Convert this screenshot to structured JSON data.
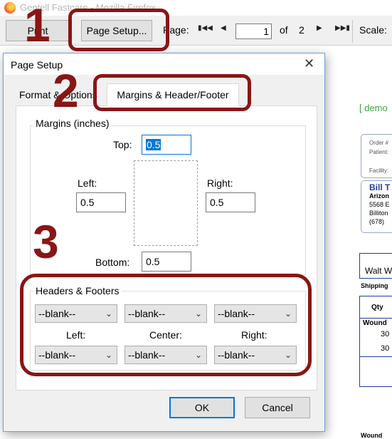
{
  "browser": {
    "window_title": "Gentell Fastcare - Mozilla Firefox",
    "icon": "firefox-logo"
  },
  "toolbar": {
    "print_label": "Print",
    "page_setup_label": "Page Setup...",
    "page_label": "Page:",
    "current_page": "1",
    "of_label": "of",
    "total_pages": "2",
    "scale_label": "Scale:",
    "nav_icons": [
      "first-page-icon",
      "prev-page-icon",
      "next-page-icon",
      "last-page-icon"
    ]
  },
  "document": {
    "demo_text": "[ demo",
    "order_lines": [
      "Order #",
      "Patient:",
      "",
      "Facility:"
    ],
    "bill_name": "Bill T",
    "bill_lines": [
      "Arizon",
      "5568 E",
      "Billiton",
      "(678)"
    ],
    "ship_to": "Walt W",
    "shipping_label": "Shipping",
    "qty_header": "Qty",
    "wound_cell": "Wound",
    "qty_values": [
      "30",
      "30"
    ],
    "wound_bottom": "Wound"
  },
  "dialog": {
    "title": "Page Setup",
    "close_glyph": "✕",
    "tabs": [
      {
        "label": "Format & Options",
        "active": false
      },
      {
        "label": "Margins & Header/Footer",
        "active": true
      }
    ],
    "margins": {
      "legend": "Margins (inches)",
      "top_label": "Top:",
      "top_value": "0.5",
      "left_label": "Left:",
      "left_value": "0.5",
      "right_label": "Right:",
      "right_value": "0.5",
      "bottom_label": "Bottom:",
      "bottom_value": "0.5"
    },
    "headers_footers": {
      "legend": "Headers & Footers",
      "header_left": "--blank--",
      "header_center": "--blank--",
      "header_right": "--blank--",
      "left_label": "Left:",
      "center_label": "Center:",
      "right_label": "Right:",
      "footer_left": "--blank--",
      "footer_center": "--blank--",
      "footer_right": "--blank--"
    },
    "ok_label": "OK",
    "cancel_label": "Cancel"
  },
  "annotations": {
    "step1": "1",
    "step2": "2",
    "step3": "3",
    "color": "#8a1515"
  },
  "colors": {
    "accent": "#0078d7",
    "demo_green": "#3aa53a",
    "doc_blue": "#1f3f9a"
  }
}
